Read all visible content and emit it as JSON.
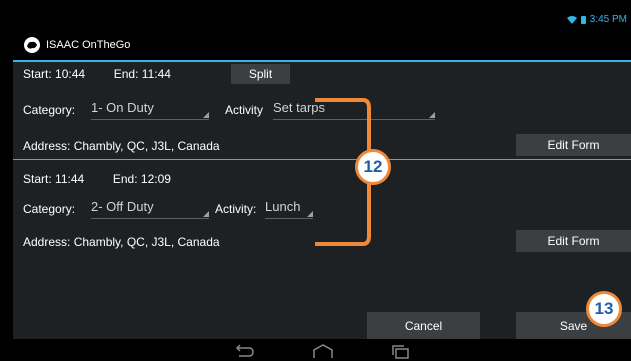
{
  "status": {
    "time": "3:45 PM"
  },
  "app": {
    "title": "ISAAC OnTheGo"
  },
  "entry1": {
    "start_label": "Start:",
    "start": "10:44",
    "end_label": "End:",
    "end": "11:44",
    "split_label": "Split",
    "category_label": "Category:",
    "category": "1- On Duty",
    "activity_label": "Activity",
    "activity": "Set tarps",
    "address_label": "Address:",
    "address": "Chambly, QC, J3L, Canada",
    "edit_label": "Edit Form"
  },
  "entry2": {
    "start_label": "Start:",
    "start": "11:44",
    "end_label": "End:",
    "end": "12:09",
    "category_label": "Category:",
    "category": "2- Off Duty",
    "activity_label": "Activity:",
    "activity": "Lunch",
    "address_label": "Address:",
    "address": "Chambly, QC, J3L, Canada",
    "edit_label": "Edit Form"
  },
  "footer": {
    "cancel_label": "Cancel",
    "save_label": "Save"
  },
  "annotations": {
    "badge_12": "12",
    "badge_13": "13",
    "accent": "#f0883a"
  },
  "colors": {
    "holo_blue": "#33b5e5",
    "panel": "#1d2124",
    "button": "#3b3f42"
  }
}
